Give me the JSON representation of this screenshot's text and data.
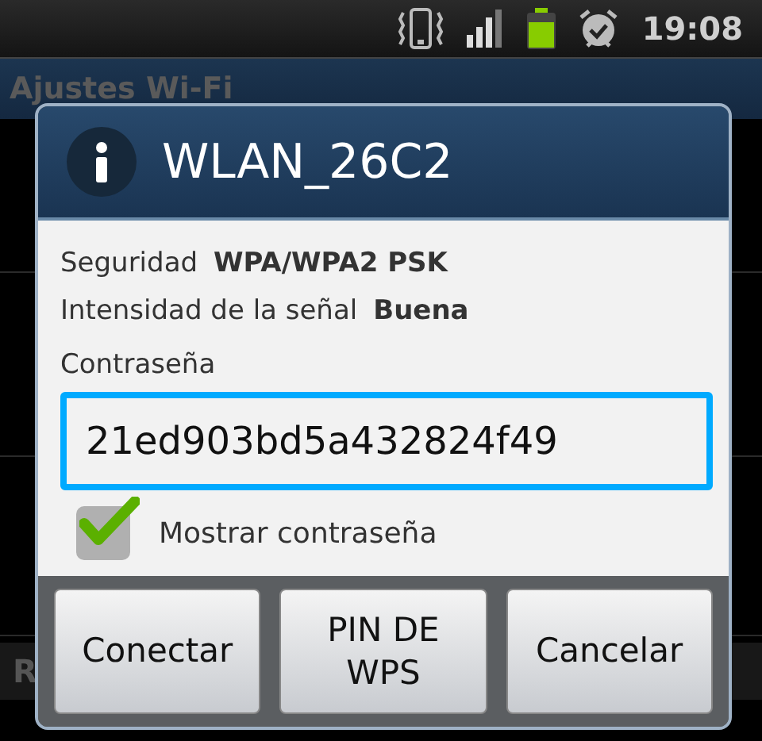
{
  "status_bar": {
    "time": "19:08"
  },
  "screen": {
    "title": "Ajustes Wi-Fi"
  },
  "background_list": {
    "section_header": "R"
  },
  "dialog": {
    "title": "WLAN_26C2",
    "details": [
      {
        "label": "Seguridad",
        "value": "WPA/WPA2 PSK"
      },
      {
        "label": "Intensidad de la señal",
        "value": "Buena"
      }
    ],
    "password": {
      "label": "Contraseña",
      "value": "21ed903bd5a432824f49",
      "focused": true
    },
    "show_password": {
      "label": "Mostrar contraseña",
      "checked": true
    },
    "buttons": [
      "Conectar",
      "PIN DE WPS",
      "Cancelar"
    ]
  }
}
